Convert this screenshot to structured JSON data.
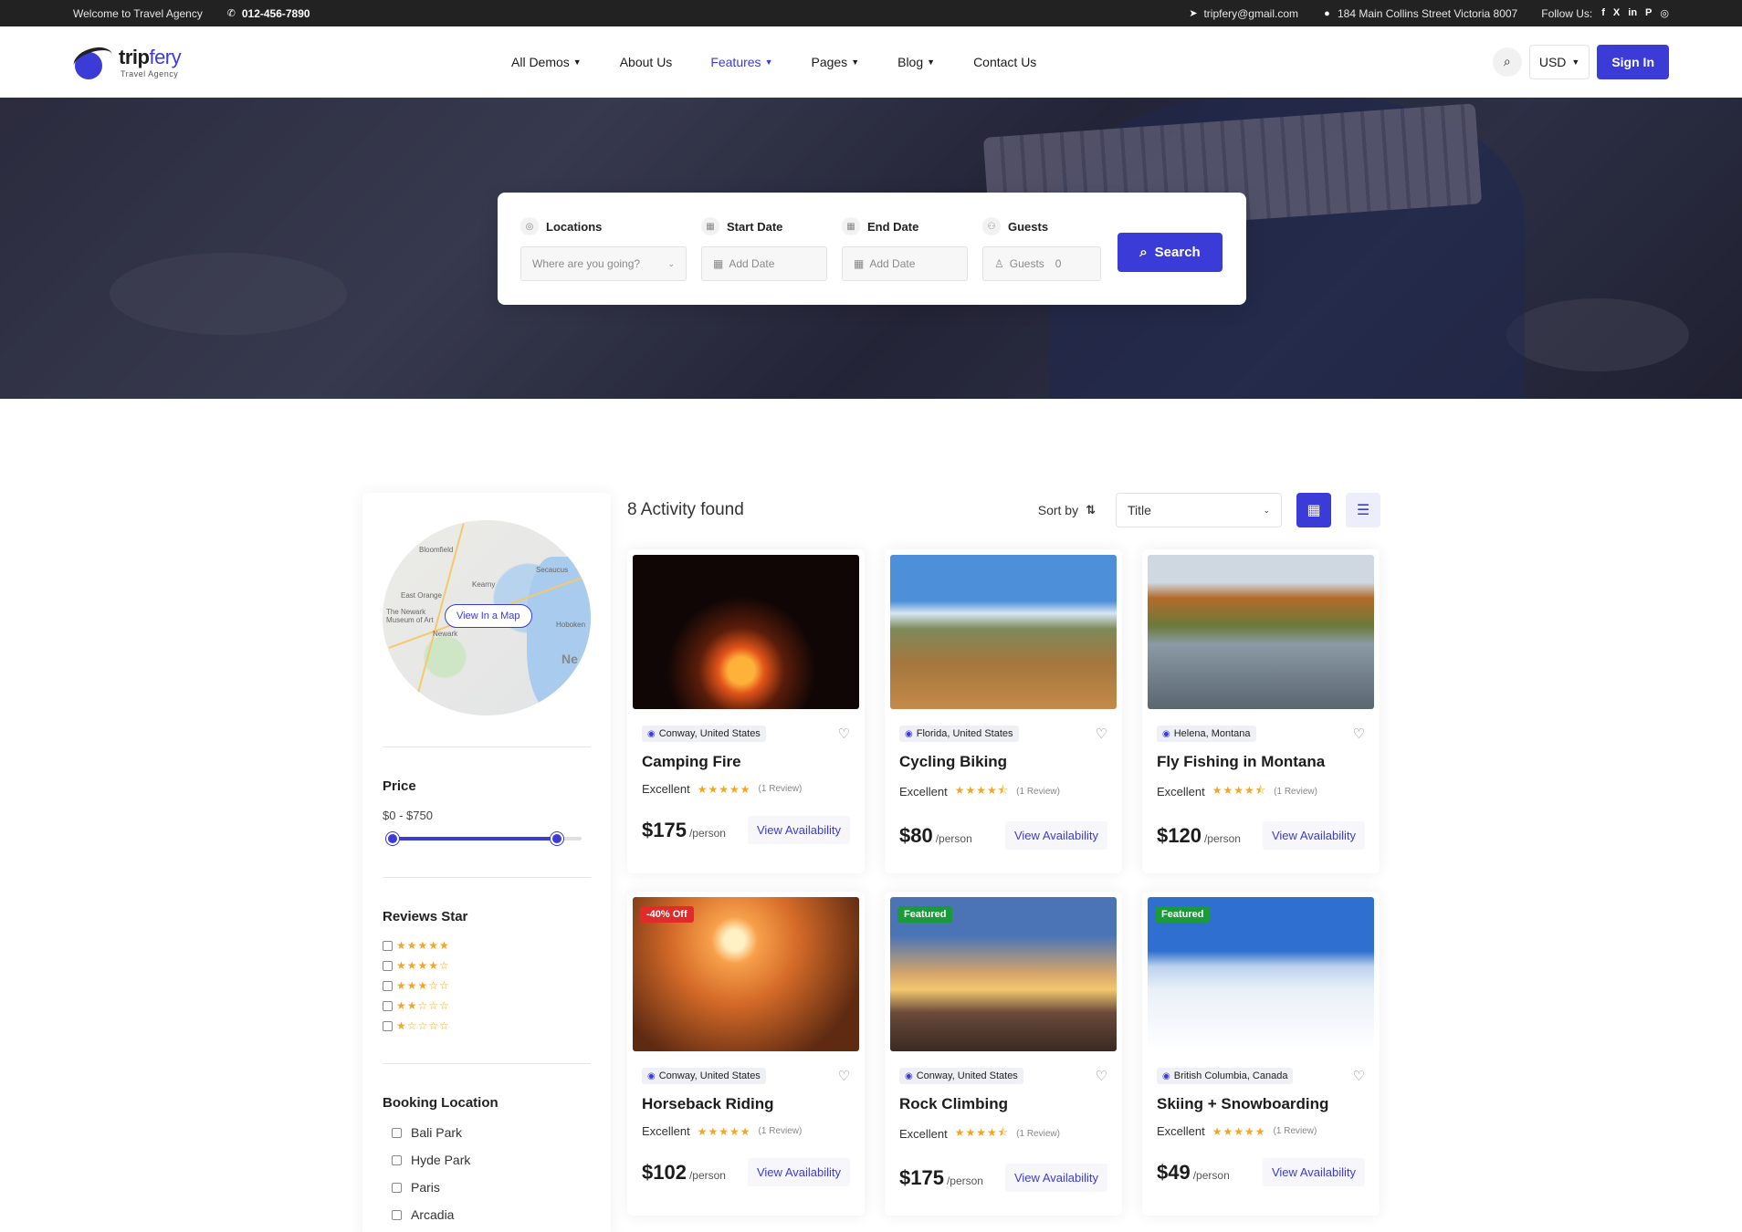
{
  "topbar": {
    "welcome": "Welcome to Travel Agency",
    "phone": "012-456-7890",
    "email": "tripfery@gmail.com",
    "address": "184 Main Collins Street Victoria 8007",
    "follow_label": "Follow Us:",
    "socials": [
      "f",
      "X",
      "in",
      "P",
      "◎"
    ]
  },
  "brand": {
    "name_part1": "trip",
    "name_part2": "fery",
    "tagline": "Travel Agency",
    "accent": "#3b3bd8"
  },
  "menu": [
    {
      "label": "All Demos",
      "dropdown": true,
      "active": false
    },
    {
      "label": "About Us",
      "dropdown": false,
      "active": false
    },
    {
      "label": "Features",
      "dropdown": true,
      "active": true
    },
    {
      "label": "Pages",
      "dropdown": true,
      "active": false
    },
    {
      "label": "Blog",
      "dropdown": true,
      "active": false
    },
    {
      "label": "Contact Us",
      "dropdown": false,
      "active": false
    }
  ],
  "nav_right": {
    "currency": "USD",
    "signin": "Sign In"
  },
  "search": {
    "locations_label": "Locations",
    "locations_placeholder": "Where are you going?",
    "start_label": "Start Date",
    "start_placeholder": "Add Date",
    "end_label": "End Date",
    "end_placeholder": "Add Date",
    "guests_label": "Guests",
    "guests_placeholder": "Guests",
    "guests_value": "0",
    "button": "Search"
  },
  "sidebar": {
    "map_button": "View In a Map",
    "map_labels": [
      "Bloomfield",
      "East Orange",
      "The Newark Museum of Art",
      "Newark",
      "Kearny",
      "Secaucus",
      "Hoboken",
      "Ne"
    ],
    "price_title": "Price",
    "price_range": "$0 - $750",
    "price_min_fraction": 0,
    "price_max_fraction": 1,
    "reviews_title": "Reviews Star",
    "review_levels": [
      5,
      4,
      3,
      2,
      1
    ],
    "booking_title": "Booking Location",
    "locations": [
      "Bali Park",
      "Hyde Park",
      "Paris",
      "Arcadia"
    ]
  },
  "results": {
    "count_text": "8 Activity found",
    "sort_label": "Sort by",
    "sort_value": "Title"
  },
  "cards": [
    {
      "location": "Conway, United States",
      "title": "Camping Fire",
      "rating_text": "Excellent",
      "stars": 5,
      "reviews": "(1 Review)",
      "price": "$175",
      "per": "/person",
      "cta": "View Availability",
      "badge": "",
      "img": "campfire"
    },
    {
      "location": "Florida, United States",
      "title": "Cycling Biking",
      "rating_text": "Excellent",
      "stars": 4.5,
      "reviews": "(1 Review)",
      "price": "$80",
      "per": "/person",
      "cta": "View Availability",
      "badge": "",
      "img": "cycling"
    },
    {
      "location": "Helena, Montana",
      "title": "Fly Fishing in Montana",
      "rating_text": "Excellent",
      "stars": 4.5,
      "reviews": "(1 Review)",
      "price": "$120",
      "per": "/person",
      "cta": "View Availability",
      "badge": "",
      "img": "fishing"
    },
    {
      "location": "Conway, United States",
      "title": "Horseback Riding",
      "rating_text": "Excellent",
      "stars": 5,
      "reviews": "(1 Review)",
      "price": "$102",
      "per": "/person",
      "cta": "View Availability",
      "badge": "-40% Off",
      "img": "horse"
    },
    {
      "location": "Conway, United States",
      "title": "Rock Climbing",
      "rating_text": "Excellent",
      "stars": 4.5,
      "reviews": "(1 Review)",
      "price": "$175",
      "per": "/person",
      "cta": "View Availability",
      "badge": "Featured",
      "img": "climbing"
    },
    {
      "location": "British Columbia, Canada",
      "title": "Skiing + Snowboarding",
      "rating_text": "Excellent",
      "stars": 5,
      "reviews": "(1 Review)",
      "price": "$49",
      "per": "/person",
      "cta": "View Availability",
      "badge": "Featured",
      "img": "skiing"
    }
  ]
}
